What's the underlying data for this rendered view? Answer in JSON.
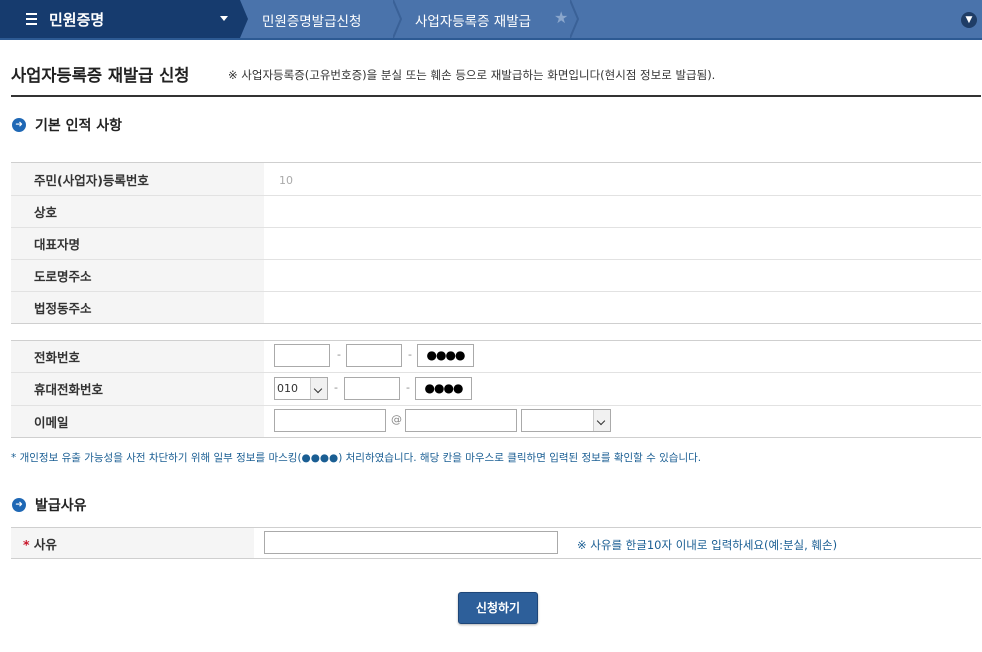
{
  "nav": {
    "menu_title": "민원증명",
    "breadcrumbs": [
      "민원증명발급신청",
      "사업자등록증 재발급"
    ]
  },
  "page": {
    "title": "사업자등록증 재발급 신청",
    "description": "※ 사업자등록증(고유번호증)을 분실 또는 훼손 등으로 재발급하는 화면입니다(현시점 정보로 발급됨)."
  },
  "basic_section": {
    "title": "기본 인적 사항",
    "rows": [
      {
        "label": "주민(사업자)등록번호",
        "value": "10"
      },
      {
        "label": "상호",
        "value": ""
      },
      {
        "label": "대표자명",
        "value": ""
      },
      {
        "label": "도로명주소",
        "value": ""
      },
      {
        "label": "법정동주소",
        "value": ""
      }
    ]
  },
  "contact": {
    "phone_label": "전화번호",
    "phone_mask": "●●●●",
    "mobile_label": "휴대전화번호",
    "mobile_prefix": "010",
    "mobile_mask": "●●●●",
    "email_label": "이메일",
    "email_at": "@",
    "dash": "-"
  },
  "notice": "* 개인정보 유출 가능성을 사전 차단하기 위해 일부 정보를 마스킹(●●●●) 처리하였습니다. 해당 칸을 마우스로 클릭하면 입력된 정보를 확인할 수 있습니다.",
  "reason_section": {
    "title": "발급사유",
    "required_mark": "*",
    "label": "사유",
    "hint": "※ 사유를 한글10자 이내로 입력하세요(예:분실, 훼손)"
  },
  "submit_label": "신청하기"
}
